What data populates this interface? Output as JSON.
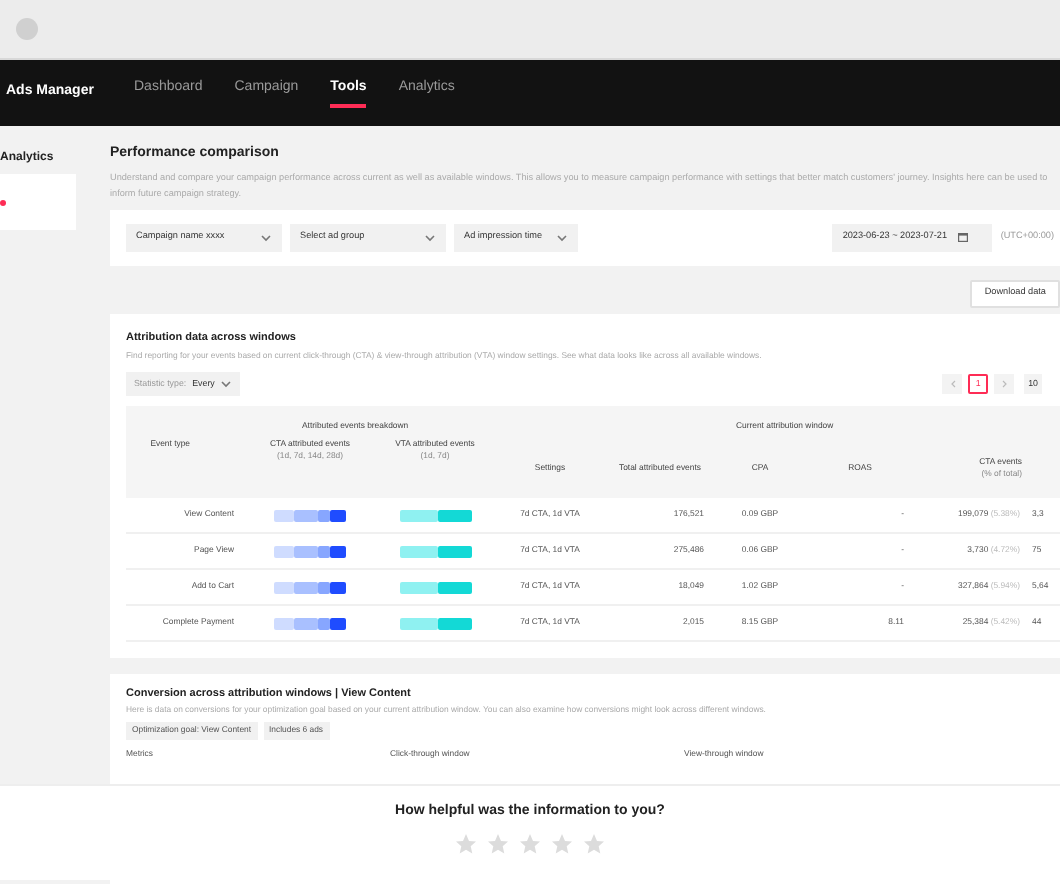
{
  "nav": {
    "brand": "Ads Manager",
    "tabs": [
      {
        "label": "Dashboard",
        "selected": false
      },
      {
        "label": "Campaign",
        "selected": false
      },
      {
        "label": "Tools",
        "selected": true
      },
      {
        "label": "Analytics",
        "selected": false
      }
    ]
  },
  "sidebar": {
    "title": "Analytics"
  },
  "page": {
    "title": "Performance comparison",
    "description": "Understand and compare your campaign performance across current as well as available windows. This allows you to measure campaign performance with settings that better match customers' journey. Insights here can be used to inform future campaign strategy."
  },
  "filters": {
    "dropdowns": [
      "Campaign name xxxx",
      "Select ad group",
      "Ad impression time"
    ],
    "date_range": "2023-06-23 ~ 2023-07-21",
    "timezone": "(UTC+00:00)"
  },
  "download_button": "Download data",
  "attribution": {
    "title": "Attribution data across windows",
    "description": "Find reporting for your events based on current click-through (CTA) & view-through attribution (VTA) window settings. See what data looks like across all available windows.",
    "statistic_label": "Statistic type:",
    "statistic_value": "Every",
    "pagination": {
      "pages": [
        {
          "label": "1",
          "selected": true
        }
      ],
      "page_size": "10"
    },
    "group_headers": [
      "Attributed events breakdown",
      "Current attribution window"
    ],
    "columns": [
      {
        "label": "Event type"
      },
      {
        "label": "CTA attributed events",
        "sub": "(1d, 7d, 14d, 28d)"
      },
      {
        "label": "VTA attributed events",
        "sub": "(1d, 7d)"
      },
      {
        "label": "Settings"
      },
      {
        "label": "Total attributed events"
      },
      {
        "label": "CPA"
      },
      {
        "label": "ROAS"
      },
      {
        "label": "CTA events",
        "sub": "(% of total)"
      }
    ],
    "rows": [
      {
        "event_type": "View Content",
        "settings": "7d CTA, 1d VTA",
        "total": "176,521",
        "cpa": "0.09 GBP",
        "roas": "-",
        "cta_events": "199,079",
        "cta_share": "(5.38%)",
        "column_9": "3,3"
      },
      {
        "event_type": "Page View",
        "settings": "7d CTA, 1d VTA",
        "total": "275,486",
        "cpa": "0.06 GBP",
        "roas": "-",
        "cta_events": "3,730",
        "cta_share": "(4.72%)",
        "column_9": "75"
      },
      {
        "event_type": "Add to Cart",
        "settings": "7d CTA, 1d VTA",
        "total": "18,049",
        "cpa": "1.02 GBP",
        "roas": "-",
        "cta_events": "327,864",
        "cta_share": "(5.94%)",
        "column_9": "5,64"
      },
      {
        "event_type": "Complete Payment",
        "settings": "7d CTA, 1d VTA",
        "total": "2,015",
        "cpa": "8.15 GBP",
        "roas": "8.11",
        "cta_events": "25,384",
        "cta_share": "(5.42%)",
        "column_9": "44"
      }
    ]
  },
  "conversion": {
    "title": "Conversion across attribution windows | View Content",
    "description": "Here is data on conversions for your optimization goal based on your current attribution window. You can also examine how conversions might look across different windows.",
    "tags": [
      "Optimization goal: View Content",
      "Includes 6 ads"
    ],
    "columns": [
      "Metrics",
      "Click-through window",
      "View-through window"
    ]
  },
  "feedback": {
    "question": "How helpful was the information to you?",
    "stars": 0
  }
}
